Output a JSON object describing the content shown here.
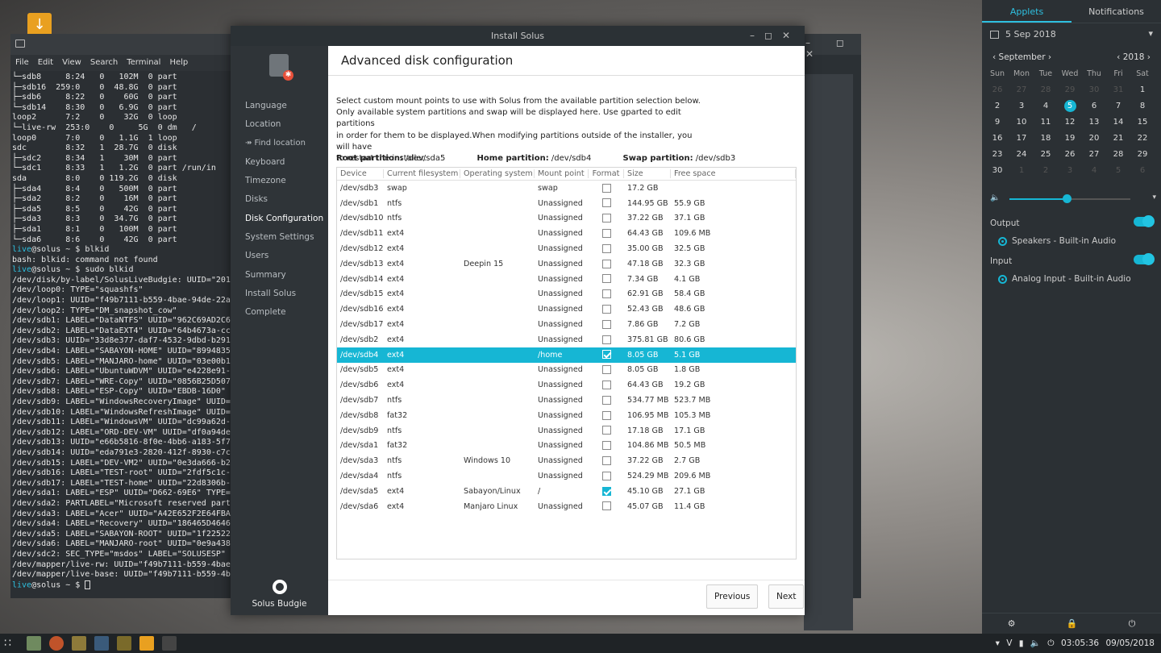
{
  "terminal": {
    "menu": [
      "File",
      "Edit",
      "View",
      "Search",
      "Terminal",
      "Help"
    ],
    "lines": [
      "└─sdb8     8:24   0   102M  0 part",
      "├─sdb16  259:0    0  48.8G  0 part",
      "├─sdb6     8:22   0    60G  0 part",
      "└─sdb14    8:30   0   6.9G  0 part",
      "loop2      7:2    0    32G  0 loop",
      "└─live-rw  253:0    0     5G  0 dm   /",
      "loop0      7:0    0   1.1G  1 loop",
      "sdc        8:32   1  28.7G  0 disk",
      "├─sdc2     8:34   1    30M  0 part",
      "└─sdc1     8:33   1   1.2G  0 part /run/in",
      "sda        8:0    0 119.2G  0 disk",
      "├─sda4     8:4    0   500M  0 part",
      "├─sda2     8:2    0    16M  0 part",
      "├─sda5     8:5    0    42G  0 part",
      "├─sda3     8:3    0  34.7G  0 part",
      "├─sda1     8:1    0   100M  0 part",
      "└─sda6     8:6    0    42G  0 part",
      "$live@solus ~ $ blkid",
      "bash: blkid: command not found",
      "$live@solus ~ $ sudo blkid",
      "/dev/disk/by-label/SolusLiveBudgie: UUID=\"201",
      "/dev/loop0: TYPE=\"squashfs\"",
      "/dev/loop1: UUID=\"f49b7111-b559-4bae-94de-22a",
      "/dev/loop2: TYPE=\"DM_snapshot_cow\"",
      "/dev/sdb1: LABEL=\"DataNTFS\" UUID=\"962C69AD2C6",
      "/dev/sdb2: LABEL=\"DataEXT4\" UUID=\"64b4673a-cc",
      "/dev/sdb3: UUID=\"33d8e377-daf7-4532-9dbd-b291",
      "/dev/sdb4: LABEL=\"SABAYON-HOME\" UUID=\"8994835",
      "/dev/sdb5: LABEL=\"MANJARO-home\" UUID=\"03e00b1",
      "/dev/sdb6: LABEL=\"UbuntuWDVM\" UUID=\"e4228e91-",
      "/dev/sdb7: LABEL=\"WRE-Copy\" UUID=\"0856B25D507",
      "/dev/sdb8: LABEL=\"ESP-Copy\" UUID=\"EBDB-16D0\"",
      "/dev/sdb9: LABEL=\"WindowsRecoveryImage\" UUID=",
      "/dev/sdb10: LABEL=\"WindowsRefreshImage\" UUID=",
      "/dev/sdb11: LABEL=\"WindowsVM\" UUID=\"dc99a62d-",
      "/dev/sdb12: LABEL=\"ORD-DEV-VM\" UUID=\"df0a94de",
      "/dev/sdb13: UUID=\"e66b5816-8f0e-4bb6-a183-5f7",
      "/dev/sdb14: UUID=\"eda791e3-2820-412f-8930-c7c",
      "/dev/sdb15: LABEL=\"DEV-VM2\" UUID=\"0e3da666-b2",
      "/dev/sdb16: LABEL=\"TEST-root\" UUID=\"2fdf5c1c-",
      "/dev/sdb17: LABEL=\"TEST-home\" UUID=\"22d8306b-",
      "/dev/sda1: LABEL=\"ESP\" UUID=\"D662-69E6\" TYPE=",
      "/dev/sda2: PARTLABEL=\"Microsoft reserved part",
      "/dev/sda3: LABEL=\"Acer\" UUID=\"A42E652F2E64FBA",
      "/dev/sda4: LABEL=\"Recovery\" UUID=\"186465D4646",
      "/dev/sda5: LABEL=\"SABAYON-ROOT\" UUID=\"1f22522",
      "/dev/sda6: LABEL=\"MANJARO-root\" UUID=\"0e9a438",
      "/dev/sdc2: SEC_TYPE=\"msdos\" LABEL=\"SOLUSESP\"",
      "/dev/mapper/live-rw: UUID=\"f49b7111-b559-4bae",
      "/dev/mapper/live-base: UUID=\"f49b7111-b559-4b",
      "$live@solus ~ $ "
    ],
    "prompt_user": "live",
    "prompt_rest": "@solus ~ $"
  },
  "installer": {
    "window_title": "Install Solus",
    "sidebar": [
      {
        "label": "Language",
        "active": false,
        "sub": false
      },
      {
        "label": "Location",
        "active": false,
        "sub": false
      },
      {
        "label": "↠ Find location",
        "active": false,
        "sub": true
      },
      {
        "label": "Keyboard",
        "active": false,
        "sub": false
      },
      {
        "label": "Timezone",
        "active": false,
        "sub": false
      },
      {
        "label": "Disks",
        "active": false,
        "sub": false
      },
      {
        "label": "Disk Configuration",
        "active": true,
        "sub": false
      },
      {
        "label": "System Settings",
        "active": false,
        "sub": false
      },
      {
        "label": "Users",
        "active": false,
        "sub": false
      },
      {
        "label": "Summary",
        "active": false,
        "sub": false
      },
      {
        "label": "Install Solus",
        "active": false,
        "sub": false
      },
      {
        "label": "Complete",
        "active": false,
        "sub": false
      }
    ],
    "brand": "Solus Budgie",
    "header": "Advanced disk configuration",
    "description": [
      "Select custom mount points to use with Solus from the available partition selection below.",
      "Only available system partitions and swap will be displayed here. Use gparted to edit partitions",
      "in order for them to be displayed.When modifying partitions outside of the installer, you will have",
      "to restart the installer."
    ],
    "partitions": {
      "root_label": "Root partition:",
      "root_value": "/dev/sda5",
      "home_label": "Home partition:",
      "home_value": "/dev/sdb4",
      "swap_label": "Swap partition:",
      "swap_value": "/dev/sdb3"
    },
    "columns": [
      "Device",
      "Current filesystem",
      "Operating system",
      "Mount point",
      "Format",
      "Size",
      "Free space"
    ],
    "rows": [
      {
        "device": "/dev/sdb3",
        "fs": "swap",
        "os": "",
        "mount": "swap",
        "format": false,
        "size": "17.2 GB",
        "free": ""
      },
      {
        "device": "/dev/sdb1",
        "fs": "ntfs",
        "os": "",
        "mount": "Unassigned",
        "format": false,
        "size": "144.95 GB",
        "free": "55.9 GB"
      },
      {
        "device": "/dev/sdb10",
        "fs": "ntfs",
        "os": "",
        "mount": "Unassigned",
        "format": false,
        "size": "37.22 GB",
        "free": "37.1 GB"
      },
      {
        "device": "/dev/sdb11",
        "fs": "ext4",
        "os": "",
        "mount": "Unassigned",
        "format": false,
        "size": "64.43 GB",
        "free": "109.6 MB"
      },
      {
        "device": "/dev/sdb12",
        "fs": "ext4",
        "os": "",
        "mount": "Unassigned",
        "format": false,
        "size": "35.00 GB",
        "free": "32.5 GB"
      },
      {
        "device": "/dev/sdb13",
        "fs": "ext4",
        "os": "Deepin 15",
        "mount": "Unassigned",
        "format": false,
        "size": "47.18 GB",
        "free": "32.3 GB"
      },
      {
        "device": "/dev/sdb14",
        "fs": "ext4",
        "os": "",
        "mount": "Unassigned",
        "format": false,
        "size": "7.34 GB",
        "free": "4.1 GB"
      },
      {
        "device": "/dev/sdb15",
        "fs": "ext4",
        "os": "",
        "mount": "Unassigned",
        "format": false,
        "size": "62.91 GB",
        "free": "58.4 GB"
      },
      {
        "device": "/dev/sdb16",
        "fs": "ext4",
        "os": "",
        "mount": "Unassigned",
        "format": false,
        "size": "52.43 GB",
        "free": "48.6 GB"
      },
      {
        "device": "/dev/sdb17",
        "fs": "ext4",
        "os": "",
        "mount": "Unassigned",
        "format": false,
        "size": "7.86 GB",
        "free": "7.2 GB"
      },
      {
        "device": "/dev/sdb2",
        "fs": "ext4",
        "os": "",
        "mount": "Unassigned",
        "format": false,
        "size": "375.81 GB",
        "free": "80.6 GB"
      },
      {
        "device": "/dev/sdb4",
        "fs": "ext4",
        "os": "",
        "mount": "/home",
        "format": true,
        "size": "8.05 GB",
        "free": "5.1 GB",
        "selected": true
      },
      {
        "device": "/dev/sdb5",
        "fs": "ext4",
        "os": "",
        "mount": "Unassigned",
        "format": false,
        "size": "8.05 GB",
        "free": "1.8 GB"
      },
      {
        "device": "/dev/sdb6",
        "fs": "ext4",
        "os": "",
        "mount": "Unassigned",
        "format": false,
        "size": "64.43 GB",
        "free": "19.2 GB"
      },
      {
        "device": "/dev/sdb7",
        "fs": "ntfs",
        "os": "",
        "mount": "Unassigned",
        "format": false,
        "size": "534.77 MB",
        "free": "523.7 MB"
      },
      {
        "device": "/dev/sdb8",
        "fs": "fat32",
        "os": "",
        "mount": "Unassigned",
        "format": false,
        "size": "106.95 MB",
        "free": "105.3 MB"
      },
      {
        "device": "/dev/sdb9",
        "fs": "ntfs",
        "os": "",
        "mount": "Unassigned",
        "format": false,
        "size": "17.18 GB",
        "free": "17.1 GB"
      },
      {
        "device": "/dev/sda1",
        "fs": "fat32",
        "os": "",
        "mount": "Unassigned",
        "format": false,
        "size": "104.86 MB",
        "free": "50.5 MB"
      },
      {
        "device": "/dev/sda3",
        "fs": "ntfs",
        "os": "Windows 10",
        "mount": "Unassigned",
        "format": false,
        "size": "37.22 GB",
        "free": "2.7 GB"
      },
      {
        "device": "/dev/sda4",
        "fs": "ntfs",
        "os": "",
        "mount": "Unassigned",
        "format": false,
        "size": "524.29 MB",
        "free": "209.6 MB"
      },
      {
        "device": "/dev/sda5",
        "fs": "ext4",
        "os": "Sabayon/Linux",
        "mount": "/",
        "format": true,
        "size": "45.10 GB",
        "free": "27.1 GB"
      },
      {
        "device": "/dev/sda6",
        "fs": "ext4",
        "os": "Manjaro Linux",
        "mount": "Unassigned",
        "format": false,
        "size": "45.07 GB",
        "free": "11.4 GB"
      }
    ],
    "buttons": {
      "previous": "Previous",
      "next": "Next"
    }
  },
  "raven": {
    "tabs": [
      "Applets",
      "Notifications"
    ],
    "date": "5 Sep 2018",
    "calendar": {
      "month": "September",
      "year": "2018",
      "day_names": [
        "Sun",
        "Mon",
        "Tue",
        "Wed",
        "Thu",
        "Fri",
        "Sat"
      ],
      "weeks": [
        [
          "26",
          "27",
          "28",
          "29",
          "30",
          "31",
          "1"
        ],
        [
          "2",
          "3",
          "4",
          "5",
          "6",
          "7",
          "8"
        ],
        [
          "9",
          "10",
          "11",
          "12",
          "13",
          "14",
          "15"
        ],
        [
          "16",
          "17",
          "18",
          "19",
          "20",
          "21",
          "22"
        ],
        [
          "23",
          "24",
          "25",
          "26",
          "27",
          "28",
          "29"
        ],
        [
          "30",
          "1",
          "2",
          "3",
          "4",
          "5",
          "6"
        ]
      ],
      "today": "5"
    },
    "volume_level": 0.47,
    "output_label": "Output",
    "output_device": "Speakers - Built-in Audio",
    "input_label": "Input",
    "input_device": "Analog Input - Built-in Audio"
  },
  "taskbar": {
    "time": "03:05:36",
    "date": "09/05/2018"
  },
  "colors": {
    "accent": "#16b6d4"
  }
}
